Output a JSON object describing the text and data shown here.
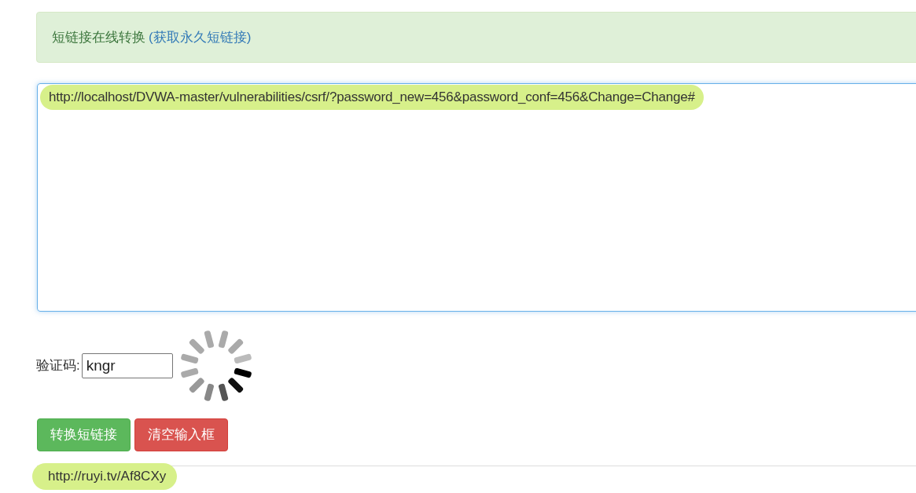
{
  "alert": {
    "title": "短链接在线转换",
    "link": "(获取永久短链接)"
  },
  "url_input": {
    "value": "http://localhost/DVWA-master/vulnerabilities/csrf/?password_new=456&password_conf=456&Change=Change#"
  },
  "captcha": {
    "label": "验证码:",
    "value": "kngr"
  },
  "buttons": [
    {
      "kind": "primary",
      "label": "转换短链接"
    },
    {
      "kind": "danger",
      "label": "清空输入框"
    }
  ],
  "result": {
    "value": "http://ruyi.tv/Af8CXy"
  }
}
